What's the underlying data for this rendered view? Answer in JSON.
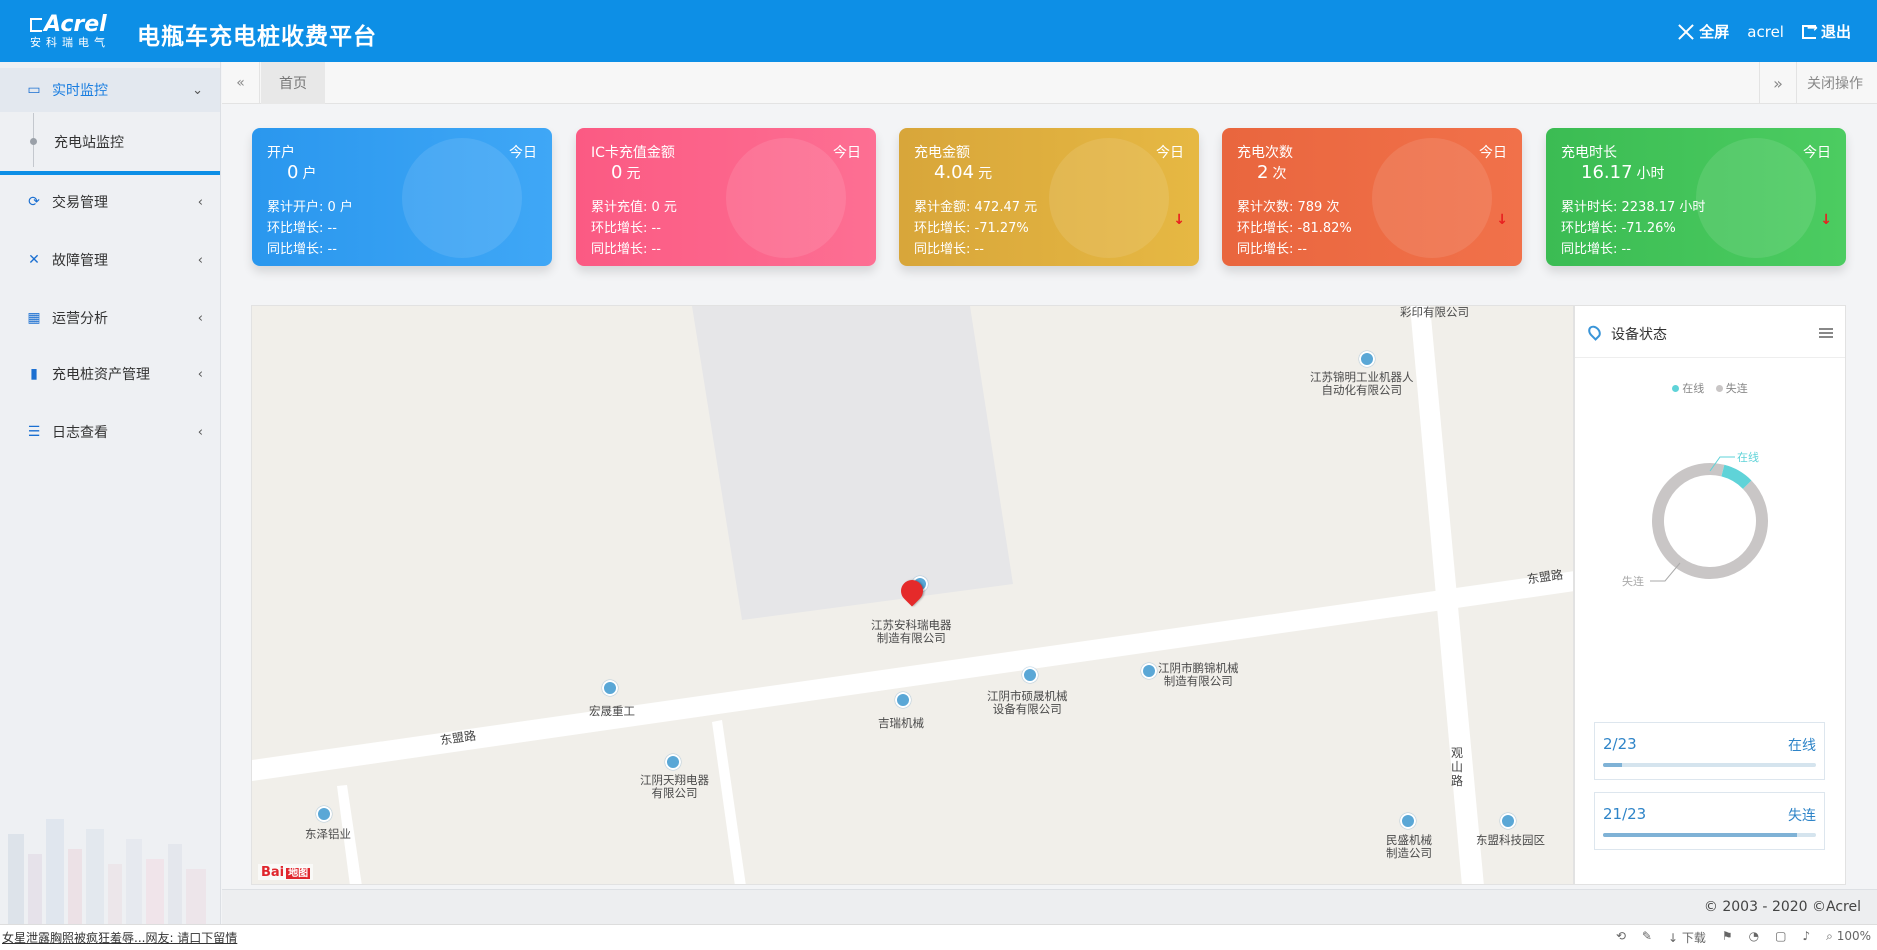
{
  "header": {
    "brand": "Acrel",
    "brand_sub": "安科瑞电气",
    "title": "电瓶车充电桩收费平台",
    "fullscreen": "全屏",
    "user": "acrel",
    "logout": "退出"
  },
  "sidebar": {
    "items": [
      {
        "label": "实时监控",
        "icon": "monitor-icon",
        "arrow": "⌄"
      },
      {
        "label": "交易管理",
        "icon": "transaction-icon",
        "arrow": "‹"
      },
      {
        "label": "故障管理",
        "icon": "wrench-icon",
        "arrow": "‹"
      },
      {
        "label": "运营分析",
        "icon": "calendar-icon",
        "arrow": "‹"
      },
      {
        "label": "充电桩资产管理",
        "icon": "charger-icon",
        "arrow": "‹"
      },
      {
        "label": "日志查看",
        "icon": "log-icon",
        "arrow": "‹"
      }
    ],
    "submenu": {
      "label": "充电站监控"
    }
  },
  "tabbar": {
    "back": "«",
    "home_tab": "首页",
    "forward": "»",
    "close_ops": "关闭操作"
  },
  "cards": [
    {
      "title": "开户",
      "today": "今日",
      "value": "0",
      "unit": "户",
      "r1": "累计开户:  0 户",
      "r2": "环比增长:  --",
      "r3": "同比增长:  --",
      "arrow": ""
    },
    {
      "title": "IC卡充值金额",
      "today": "今日",
      "value": "0",
      "unit": "元",
      "r1": "累计充值:  0 元",
      "r2": "环比增长:  --",
      "r3": "同比增长:  --",
      "arrow": ""
    },
    {
      "title": "充电金额",
      "today": "今日",
      "value": "4.04",
      "unit": "元",
      "r1": "累计金额:  472.47 元",
      "r2": "环比增长:  -71.27%",
      "r3": "同比增长:  --",
      "arrow": "↓"
    },
    {
      "title": "充电次数",
      "today": "今日",
      "value": "2",
      "unit": "次",
      "r1": "累计次数:  789 次",
      "r2": "环比增长:  -81.82%",
      "r3": "同比增长:  --",
      "arrow": "↓"
    },
    {
      "title": "充电时长",
      "today": "今日",
      "value": "16.17",
      "unit": "小时",
      "r1": "累计时长:  2238.17 小时",
      "r2": "环比增长:  -71.26%",
      "r3": "同比增长:  --",
      "arrow": "↓"
    }
  ],
  "map": {
    "pois": [
      "彩印有限公司",
      "江苏锦明工业机器人\n自动化有限公司",
      "江苏安科瑞电器\n制造有限公司",
      "宏晟重工",
      "吉瑞机械",
      "江阴市硕晟机械\n设备有限公司",
      "江阴市鹏锦机械\n制造有限公司",
      "江阴天翔电器\n有限公司",
      "东泽铝业",
      "民盛机械\n制造公司",
      "东盟科技园区"
    ],
    "roads": [
      "东盟路",
      "东盟路",
      "观\n山\n路"
    ],
    "baidu": "Bai",
    "baidu_tag": "地图"
  },
  "device_panel": {
    "title": "设备状态",
    "legend_online": "在线",
    "legend_offline": "失连",
    "donut_online_label": "在线",
    "donut_offline_label": "失连",
    "online_count": "2/23",
    "online_label": "在线",
    "online_fraction": 0.087,
    "offline_count": "21/23",
    "offline_label": "失连",
    "offline_fraction": 0.913,
    "colors": {
      "online": "#5fd3d8",
      "offline": "#c9c6c6"
    }
  },
  "footer": {
    "copyright": "© 2003 - 2020 ©Acrel"
  },
  "statusbar": {
    "news": "女星泄露胸照被疯狂羞辱...网友: 请口下留情",
    "download": "下载",
    "zoom": "100%"
  }
}
